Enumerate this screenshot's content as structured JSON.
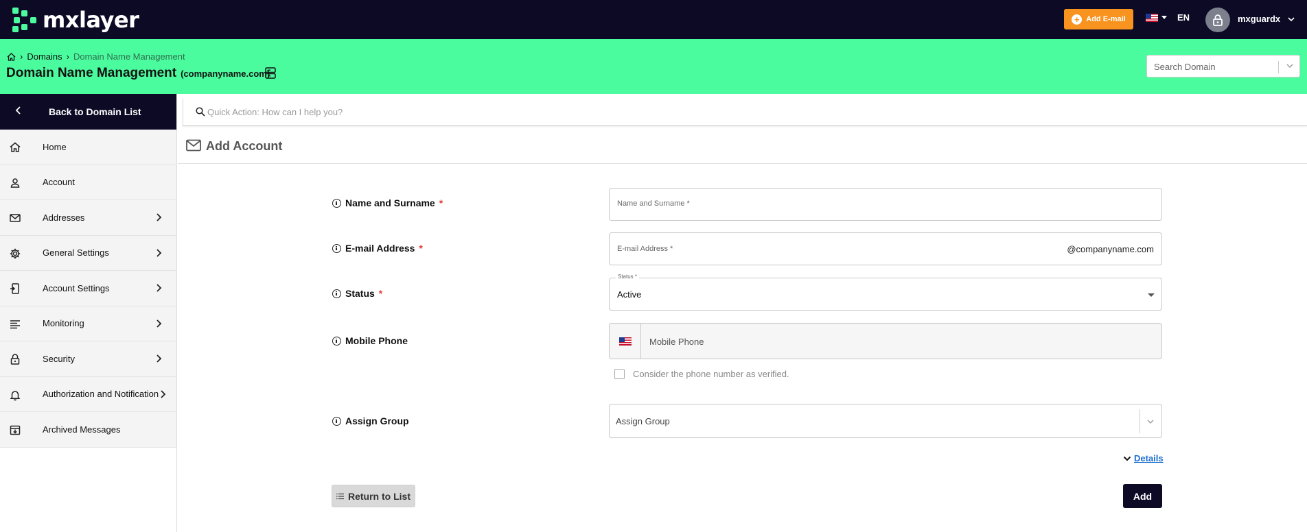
{
  "header": {
    "logo_text": "mxlayer",
    "add_email_label": "Add E-mail",
    "language": "EN",
    "username": "mxguardx",
    "brand_color": "#4bfc9e",
    "dark_color": "#0d0a26",
    "accent_color": "#f7931e"
  },
  "breadcrumb": {
    "items": [
      "Domains",
      "Domain Name Management"
    ]
  },
  "page": {
    "title": "Domain Name Management",
    "domain": "(companyname.com)",
    "search_domain_placeholder": "Search Domain"
  },
  "sidebar": {
    "back_label": "Back to Domain List",
    "items": [
      {
        "label": "Home",
        "icon": "home-icon",
        "has_submenu": false
      },
      {
        "label": "Account",
        "icon": "user-icon",
        "has_submenu": false
      },
      {
        "label": "Addresses",
        "icon": "mail-icon",
        "has_submenu": true
      },
      {
        "label": "General Settings",
        "icon": "gear-icon",
        "has_submenu": true
      },
      {
        "label": "Account Settings",
        "icon": "account-settings-icon",
        "has_submenu": true
      },
      {
        "label": "Monitoring",
        "icon": "list-icon",
        "has_submenu": true
      },
      {
        "label": "Security",
        "icon": "lock-icon",
        "has_submenu": true
      },
      {
        "label": "Authorization and Notification",
        "icon": "bell-icon",
        "has_submenu": true
      },
      {
        "label": "Archived Messages",
        "icon": "archive-icon",
        "has_submenu": false
      }
    ]
  },
  "quick_action": {
    "placeholder": "Quick Action: How can I help you?"
  },
  "form": {
    "title": "Add Account",
    "name": {
      "label": "Name and Surname",
      "required": "*",
      "placeholder": "Name and Surname *"
    },
    "email": {
      "label": "E-mail Address",
      "required": "*",
      "placeholder": "E-mail Address *",
      "suffix": "@companyname.com"
    },
    "status": {
      "label": "Status",
      "required": "*",
      "legend": "Status *",
      "value": "Active"
    },
    "mobile": {
      "label": "Mobile Phone",
      "placeholder": "Mobile Phone",
      "verified_label": "Consider the phone number as verified."
    },
    "group": {
      "label": "Assign Group",
      "placeholder": "Assign Group"
    },
    "details_label": "Details",
    "return_label": "Return to List",
    "add_label": "Add"
  }
}
